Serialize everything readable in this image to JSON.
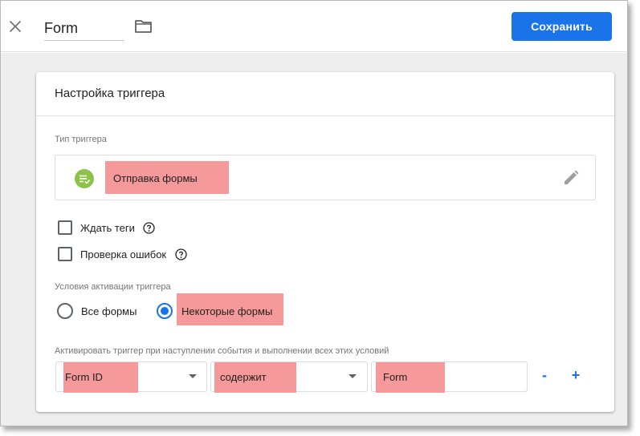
{
  "topbar": {
    "title_value": "Form",
    "save_label": "Сохранить",
    "icons": {
      "close": "close-icon",
      "folder": "folder-icon"
    }
  },
  "card": {
    "title": "Настройка триггера",
    "trigger_type": {
      "label": "Тип триггера",
      "value": "Отправка формы",
      "icon": "form-submit-icon",
      "edit_icon": "pencil-icon"
    },
    "options": [
      {
        "label": "Ждать теги",
        "checked": false
      },
      {
        "label": "Проверка ошибок",
        "checked": false
      }
    ],
    "activation": {
      "label": "Условия активации триггера",
      "choices": [
        {
          "label": "Все формы",
          "selected": false
        },
        {
          "label": "Некоторые формы",
          "selected": true
        }
      ]
    },
    "condition": {
      "label": "Активировать триггер при наступлении события и выполнении всех этих условий",
      "variable": "Form ID",
      "operator": "содержит",
      "value": "Form",
      "remove_label": "-",
      "add_label": "+"
    }
  },
  "colors": {
    "accent": "#1a73e8",
    "highlight": "#f5999a",
    "form_icon": "#8bc34a",
    "background": "#eeeeee"
  }
}
